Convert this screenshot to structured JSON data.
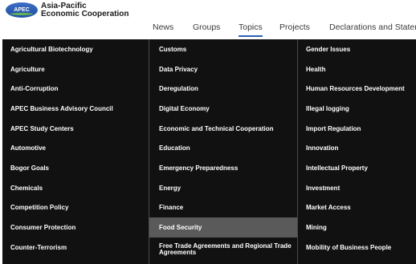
{
  "logo": {
    "badge": "APEC",
    "line1": "Asia-Pacific",
    "line2": "Economic Cooperation"
  },
  "nav": [
    "News",
    "Groups",
    "Topics",
    "Projects",
    "Declarations and Statem"
  ],
  "active_nav": "Topics",
  "menu": {
    "col1": [
      "Agricultural Biotechnology",
      "Agriculture",
      "Anti-Corruption",
      "APEC Business Advisory Council",
      "APEC Study Centers",
      "Automotive",
      "Bogor Goals",
      "Chemicals",
      "Competition Policy",
      "Consumer Protection",
      "Counter-Terrorism"
    ],
    "col2": [
      "Customs",
      "Data Privacy",
      "Deregulation",
      "Digital Economy",
      "Economic and Technical Cooperation",
      "Education",
      "Emergency Preparedness",
      "Energy",
      "Finance",
      "Food Security",
      "Free Trade Agreements and Regional Trade Agreements"
    ],
    "col3": [
      "Gender Issues",
      "Health",
      "Human Resources Development",
      "Illegal logging",
      "Import Regulation",
      "Innovation",
      "Intellectual Property",
      "Investment",
      "Market Access",
      "Mining",
      "Mobility of Business People"
    ],
    "highlighted": "Food Security"
  },
  "colors": {
    "menu_bg": "#111111",
    "highlight": "#5a5a5a",
    "accent": "#2b5fb3"
  }
}
